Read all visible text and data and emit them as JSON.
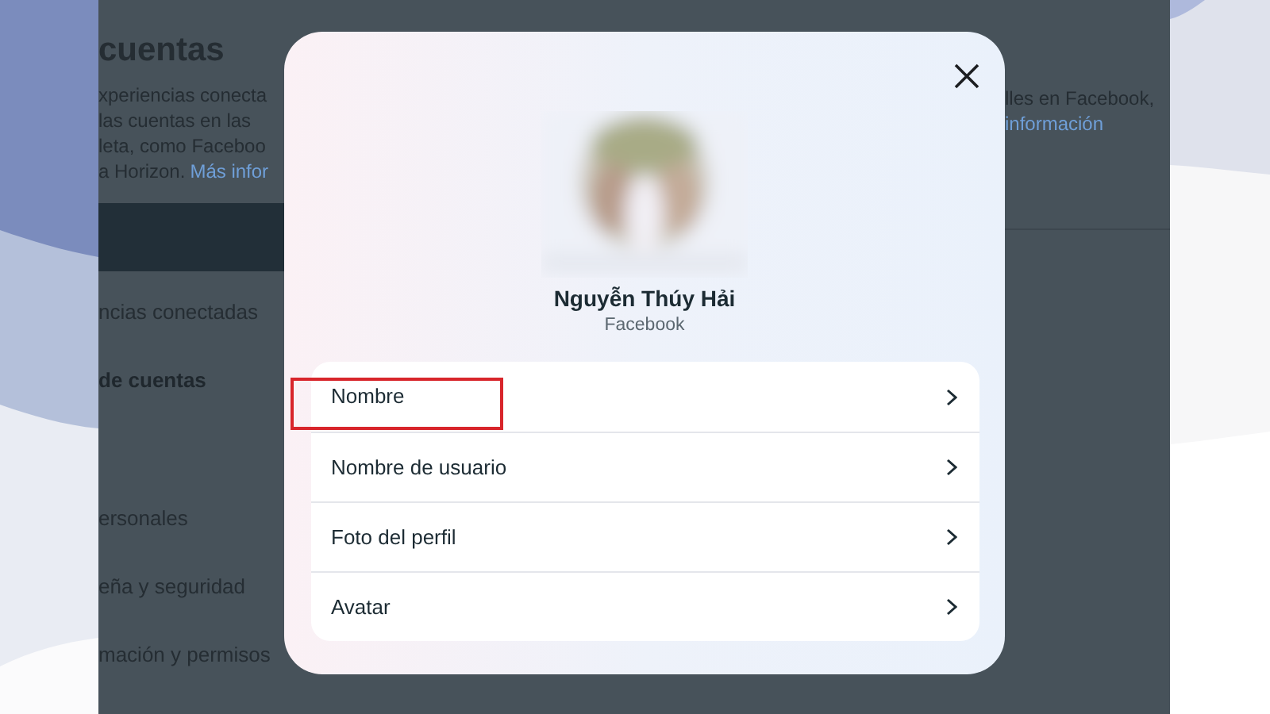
{
  "background_page": {
    "title": "cuentas",
    "description_lines": [
      "xperiencias conecta",
      "las cuentas en las",
      "leta, como Faceboo",
      "a Horizon."
    ],
    "description_link": "Más infor",
    "right_text": "lles en Facebook,",
    "right_link": "información",
    "nav_items": [
      {
        "label": "ncias conectadas",
        "kind": "item"
      },
      {
        "label": "de cuentas",
        "kind": "heading"
      },
      {
        "label": "ersonales",
        "kind": "item"
      },
      {
        "label": "eña y seguridad",
        "kind": "item"
      },
      {
        "label": "mación y permisos",
        "kind": "item"
      }
    ]
  },
  "dialog": {
    "profile": {
      "name": "Nguyễn Thúy Hải",
      "platform": "Facebook"
    },
    "rows": [
      {
        "label": "Nombre",
        "highlighted": true
      },
      {
        "label": "Nombre de usuario",
        "highlighted": false
      },
      {
        "label": "Foto del perfil",
        "highlighted": false
      },
      {
        "label": "Avatar",
        "highlighted": false
      }
    ]
  }
}
